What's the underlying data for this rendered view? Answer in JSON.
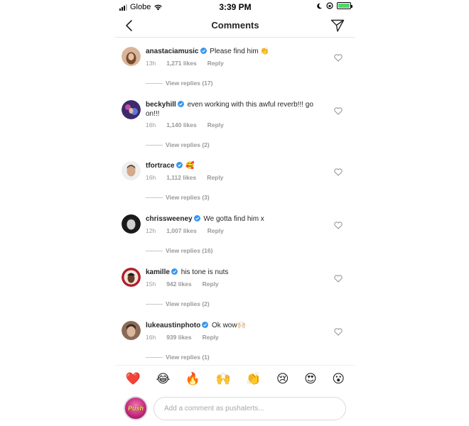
{
  "status_bar": {
    "carrier": "Globe",
    "time": "3:39 PM",
    "battery_color": "#4cd964"
  },
  "header": {
    "title": "Comments",
    "back_icon": "chevron-left-icon",
    "share_icon": "paper-plane-icon"
  },
  "comments": [
    {
      "username": "anastaciamusic",
      "verified": true,
      "text": "Please find him 👏",
      "time": "13h",
      "likes": "1,271 likes",
      "reply": "Reply",
      "view_replies": "View replies (17)",
      "avatar_colors": [
        "#d8b49a",
        "#7a4a2c"
      ]
    },
    {
      "username": "beckyhill",
      "verified": true,
      "text": "even working with this awful reverb!!! go on!!!",
      "time": "16h",
      "likes": "1,140 likes",
      "reply": "Reply",
      "view_replies": "View replies (2)",
      "avatar_colors": [
        "#3d2a6a",
        "#c24aa8"
      ]
    },
    {
      "username": "tfortrace",
      "verified": true,
      "text": "🥰",
      "time": "16h",
      "likes": "1,112 likes",
      "reply": "Reply",
      "view_replies": "View replies (3)",
      "avatar_colors": [
        "#e6e6e6",
        "#5b4a40"
      ]
    },
    {
      "username": "chrissweeney",
      "verified": true,
      "text": "We gotta find him x",
      "time": "12h",
      "likes": "1,007 likes",
      "reply": "Reply",
      "view_replies": "View replies (16)",
      "avatar_colors": [
        "#cfcfcf",
        "#222222"
      ]
    },
    {
      "username": "kamille",
      "verified": true,
      "text": "his tone is nuts",
      "time": "15h",
      "likes": "942 likes",
      "reply": "Reply",
      "view_replies": "View replies (2)",
      "avatar_colors": [
        "#b01e2a",
        "#f1e5dc"
      ]
    },
    {
      "username": "lukeaustinphoto",
      "verified": true,
      "text": "Ok wow🙌🏻",
      "time": "16h",
      "likes": "939 likes",
      "reply": "Reply",
      "view_replies": "View replies (1)",
      "avatar_colors": [
        "#8b6a55",
        "#3a2a22"
      ]
    }
  ],
  "emoji_bar": [
    "❤️",
    "😂",
    "🔥",
    "🙌",
    "👏",
    "😢",
    "😍",
    "😮"
  ],
  "input": {
    "placeholder": "Add a comment as pushalerts...",
    "avatar_label": "Push",
    "value": ""
  },
  "colors": {
    "verified_blue": "#3897f0",
    "meta_gray": "#999999"
  }
}
